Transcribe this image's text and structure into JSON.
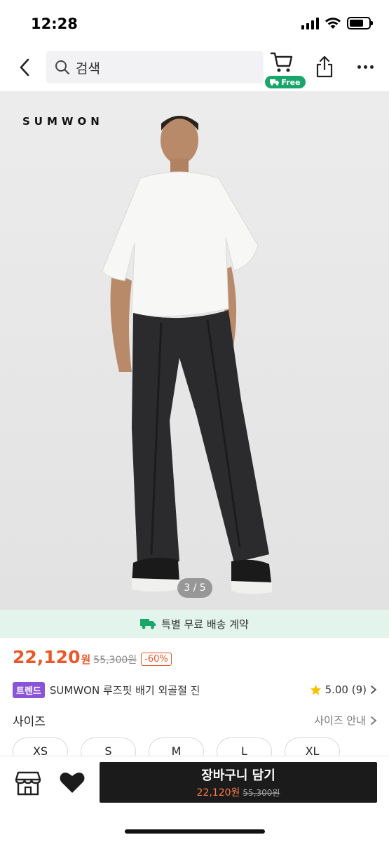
{
  "status": {
    "time": "12:28"
  },
  "nav": {
    "search_placeholder": "검색",
    "free_badge": "Free"
  },
  "product": {
    "brand_logo": "SUMWON",
    "image_indicator": "3 / 5",
    "shipping_banner": "특별 무료 배송 계약",
    "price_now": "22,120",
    "price_unit": "원",
    "price_original": "55,300원",
    "discount": "-60%",
    "trend_badge": "트렌드",
    "title": "SUMWON 루즈핏 배기 외골절 진",
    "rating": "5.00 (9)"
  },
  "sizes": {
    "label": "사이즈",
    "guide": "사이즈 안내",
    "options": [
      "XS",
      "S",
      "M",
      "L",
      "XL"
    ]
  },
  "bottom": {
    "add_to_cart": "장바구니 담기",
    "price_now": "22,120원",
    "price_original": "55,300원"
  },
  "colors": {
    "accent": "#e8582b",
    "green": "#1aa66b",
    "trend": "#8a54d9",
    "banner_bg": "#e3f4ec",
    "cta_bg": "#1b1b1b"
  },
  "icons": [
    "back-chevron-icon",
    "search-icon",
    "cart-icon",
    "truck-icon",
    "share-icon",
    "more-icon",
    "star-icon",
    "chevron-right-icon",
    "store-icon",
    "heart-icon"
  ]
}
